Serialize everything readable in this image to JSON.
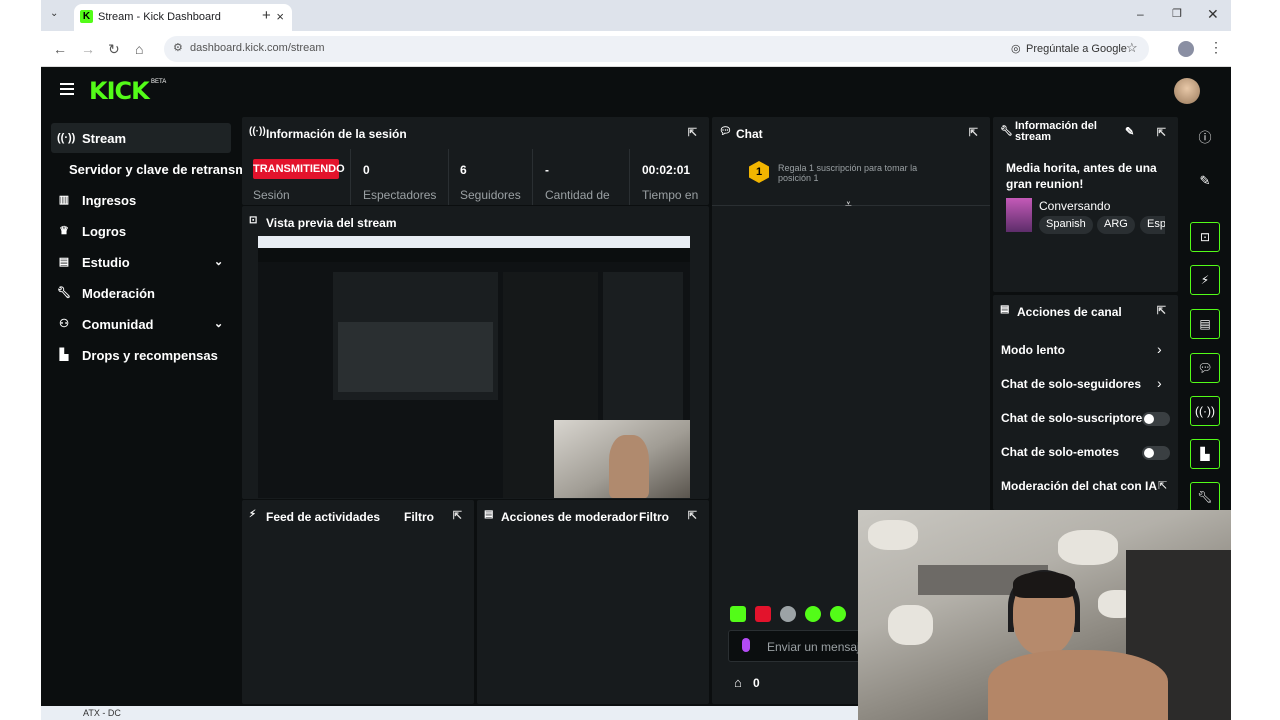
{
  "browser": {
    "tab_title": "Stream - Kick Dashboard",
    "url": "dashboard.kick.com/stream",
    "ask_google": "Pregúntale a Google"
  },
  "kick": {
    "logo": "KICK",
    "logo_badge": "BETA"
  },
  "sidebar": {
    "items": [
      {
        "label": "Stream",
        "icon": "broadcast-icon"
      },
      {
        "label": "Servidor y clave de retransm",
        "icon": ""
      },
      {
        "label": "Ingresos",
        "icon": "chart-icon"
      },
      {
        "label": "Logros",
        "icon": "trophy-icon"
      },
      {
        "label": "Estudio",
        "icon": "studio-icon"
      },
      {
        "label": "Moderación",
        "icon": "wrench-icon"
      },
      {
        "label": "Comunidad",
        "icon": "community-icon"
      },
      {
        "label": "Drops y recompensas",
        "icon": "drops-icon"
      }
    ]
  },
  "session": {
    "title": "Información de la sesión",
    "status": "TRANSMITIENDO",
    "status_label": "Sesión",
    "stats": [
      {
        "value": "0",
        "label": "Espectadores"
      },
      {
        "value": "6",
        "label": "Seguidores"
      },
      {
        "value": "-",
        "label": "Cantidad de"
      },
      {
        "value": "00:02:01",
        "label": "Tiempo en"
      }
    ]
  },
  "preview": {
    "title": "Vista previa del stream"
  },
  "feed": {
    "title": "Feed de actividades",
    "filter": "Filtro"
  },
  "modactions": {
    "title": "Acciones de moderador",
    "filter": "Filtro"
  },
  "chat": {
    "title": "Chat",
    "sub_rank": "1",
    "sub_text": "Regala 1 suscripción para tomar la posición 1",
    "input_placeholder": "Enviar un mensaje",
    "viewer_count": "0"
  },
  "stream_info": {
    "title": "Información del stream",
    "stream_title": "Media horita, antes de una gran reunion!",
    "category": "Conversando",
    "tags": [
      "Spanish",
      "ARG",
      "Esp"
    ]
  },
  "channel_actions": {
    "title": "Acciones de canal",
    "items": [
      {
        "label": "Modo lento",
        "control": "chevron"
      },
      {
        "label": "Chat de solo-seguidores",
        "control": "chevron"
      },
      {
        "label": "Chat de solo-suscriptores",
        "control": "toggle",
        "on": false
      },
      {
        "label": "Chat de solo-emotes",
        "control": "toggle",
        "on": false
      },
      {
        "label": "Moderación del chat con IA",
        "control": "popout"
      }
    ]
  },
  "taskbar": {
    "label": "ATX - DC"
  },
  "colors": {
    "accent": "#53fc18",
    "live": "#e3132c",
    "panel": "#171b1d",
    "bg": "#0b0e0f"
  }
}
